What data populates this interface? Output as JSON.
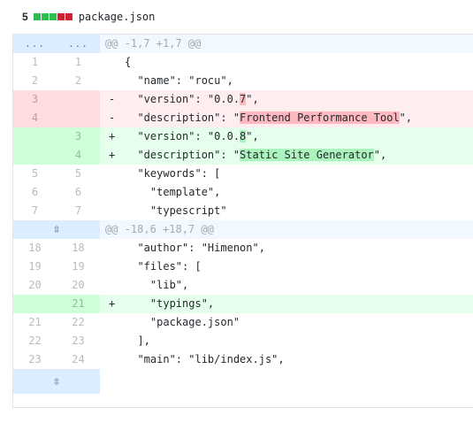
{
  "file": {
    "change_count": "5",
    "diffstat": [
      "add",
      "add",
      "add",
      "del",
      "del"
    ],
    "name": "package.json",
    "colors": {
      "add": "#2cbe4e",
      "del": "#cb2431",
      "hunk_bg": "#f1f8ff",
      "add_bg": "#e6ffed",
      "del_bg": "#ffeef0"
    }
  },
  "hunks": {
    "first_header": "@@ -1,7 +1,7 @@",
    "first_dots_old": "...",
    "first_dots_new": "...",
    "second_header": "@@ -18,6 +18,7 @@",
    "expand_icon": "⇳"
  },
  "lines": [
    {
      "type": "ctx",
      "old": "1",
      "new": "1",
      "sign": "",
      "code": "{"
    },
    {
      "type": "ctx",
      "old": "2",
      "new": "2",
      "sign": "",
      "code": "  \"name\": \"rocu\","
    },
    {
      "type": "del",
      "old": "3",
      "new": "",
      "sign": "-",
      "pre": "  \"version\": \"0.0.",
      "hl": "7",
      "post": "\","
    },
    {
      "type": "del",
      "old": "4",
      "new": "",
      "sign": "-",
      "pre": "  \"description\": \"",
      "hl": "Frontend Performance Tool",
      "post": "\","
    },
    {
      "type": "add",
      "old": "",
      "new": "3",
      "sign": "+",
      "pre": "  \"version\": \"0.0.",
      "hl": "8",
      "post": "\","
    },
    {
      "type": "add",
      "old": "",
      "new": "4",
      "sign": "+",
      "pre": "  \"description\": \"",
      "hl": "Static Site Generator",
      "post": "\","
    },
    {
      "type": "ctx",
      "old": "5",
      "new": "5",
      "sign": "",
      "code": "  \"keywords\": ["
    },
    {
      "type": "ctx",
      "old": "6",
      "new": "6",
      "sign": "",
      "code": "    \"template\","
    },
    {
      "type": "ctx",
      "old": "7",
      "new": "7",
      "sign": "",
      "code": "    \"typescript\""
    }
  ],
  "lines2": [
    {
      "type": "ctx",
      "old": "18",
      "new": "18",
      "sign": "",
      "code": "  \"author\": \"Himenon\","
    },
    {
      "type": "ctx",
      "old": "19",
      "new": "19",
      "sign": "",
      "code": "  \"files\": ["
    },
    {
      "type": "ctx",
      "old": "20",
      "new": "20",
      "sign": "",
      "code": "    \"lib\","
    },
    {
      "type": "add",
      "old": "",
      "new": "21",
      "sign": "+",
      "code": "    \"typings\","
    },
    {
      "type": "ctx",
      "old": "21",
      "new": "22",
      "sign": "",
      "code": "    \"package.json\""
    },
    {
      "type": "ctx",
      "old": "22",
      "new": "23",
      "sign": "",
      "code": "  ],"
    },
    {
      "type": "ctx",
      "old": "23",
      "new": "24",
      "sign": "",
      "code": "  \"main\": \"lib/index.js\","
    }
  ]
}
